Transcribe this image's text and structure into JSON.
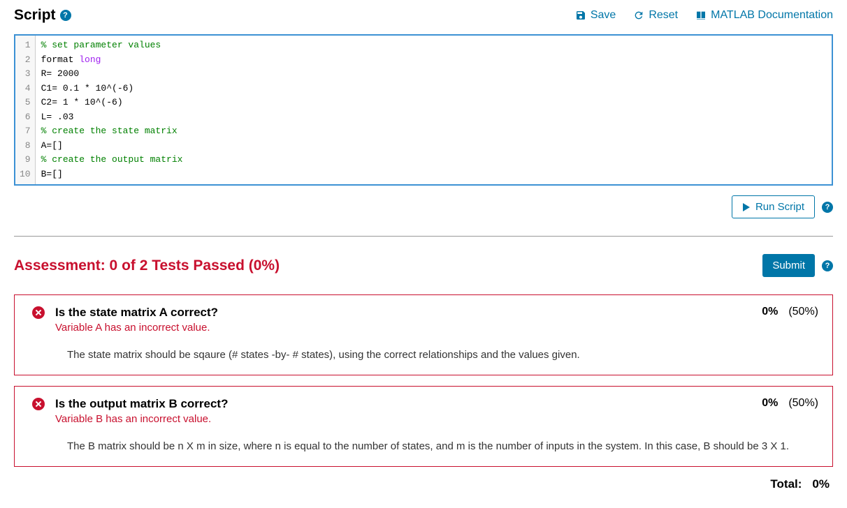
{
  "header": {
    "title": "Script",
    "save_label": "Save",
    "reset_label": "Reset",
    "docs_label": "MATLAB Documentation"
  },
  "code": {
    "line_count": 10,
    "lines": [
      {
        "n": 1,
        "text": "% set parameter values",
        "cls": "tok-comment"
      },
      {
        "n": 2,
        "parts": [
          {
            "t": "format ",
            "c": ""
          },
          {
            "t": "long",
            "c": "tok-keyword"
          }
        ]
      },
      {
        "n": 3,
        "text": "R= 2000"
      },
      {
        "n": 4,
        "text": "C1= 0.1 * 10^(-6)"
      },
      {
        "n": 5,
        "text": "C2= 1 * 10^(-6)"
      },
      {
        "n": 6,
        "text": "L= .03"
      },
      {
        "n": 7,
        "text": "% create the state matrix",
        "cls": "tok-comment"
      },
      {
        "n": 8,
        "text": "A=[]"
      },
      {
        "n": 9,
        "text": "% create the output matrix",
        "cls": "tok-comment"
      },
      {
        "n": 10,
        "text": "B=[]"
      }
    ]
  },
  "run": {
    "label": "Run Script"
  },
  "assessment": {
    "title": "Assessment: 0 of 2 Tests Passed (0%)",
    "submit_label": "Submit",
    "tests": [
      {
        "title": "Is the state matrix A correct?",
        "score": "0%",
        "weight": "(50%)",
        "msg": "Variable A has an incorrect value.",
        "detail": "The state matrix should be sqaure (# states -by- # states), using the correct relationships and the values given."
      },
      {
        "title": "Is the output matrix B correct?",
        "score": "0%",
        "weight": "(50%)",
        "msg": "Variable B has an incorrect value.",
        "detail": "The B matrix should be n X m in size, where n is equal to the number of states, and m is the number of inputs in the system. In this case, B should be 3 X 1."
      }
    ],
    "total_label": "Total:",
    "total_value": "0%"
  }
}
